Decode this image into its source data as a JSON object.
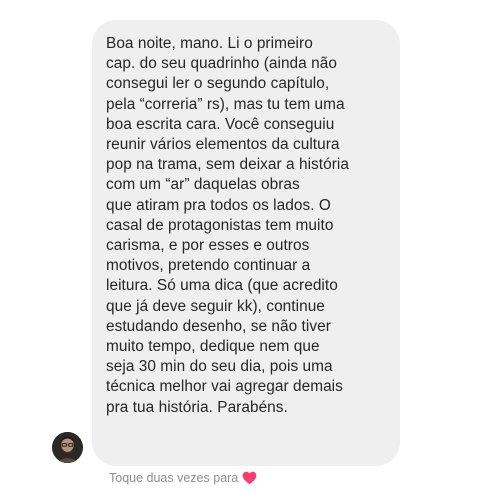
{
  "message": {
    "lines": [
      "Boa noite, mano. Li o primeiro",
      "cap. do seu quadrinho (ainda não",
      "consegui ler o segundo capítulo,",
      "pela “correria” rs), mas tu tem uma",
      "boa escrita cara. Você conseguiu",
      "reunir vários elementos da cultura",
      "pop na trama, sem deixar a história",
      "com um “ar” daquelas obras",
      "que atiram pra todos os lados. O",
      "casal de protagonistas tem muito",
      "carisma, e por esses e outros",
      "motivos, pretendo continuar a",
      "leitura. Só uma dica (que acredito",
      "que já deve seguir kk), continue",
      "estudando desenho, se não tiver",
      "muito tempo, dedique nem que",
      "seja 30 min do seu dia, pois uma",
      "técnica melhor vai agregar demais",
      "pra tua história. Parabéns."
    ]
  },
  "hint": {
    "text": "Toque duas vezes para",
    "icon": "heart-icon"
  },
  "colors": {
    "bubble": "#efefef",
    "text": "#262626",
    "hint_text": "#8e8e8e",
    "heart": "#ff3b6b"
  }
}
